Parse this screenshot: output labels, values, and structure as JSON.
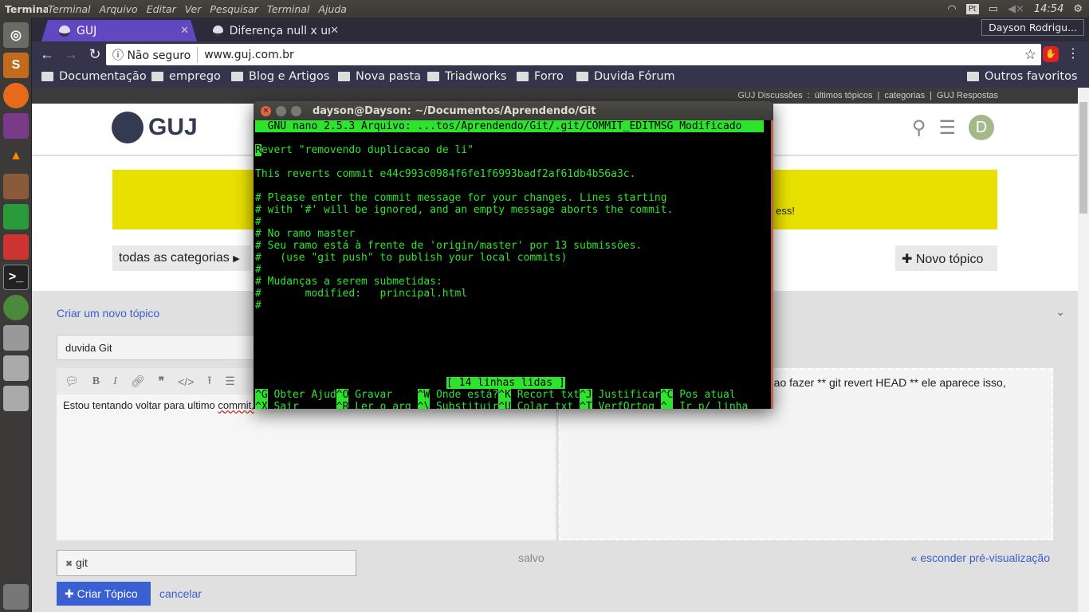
{
  "ubuntu": {
    "app": "Terminal",
    "menu": [
      "Terminal",
      "Arquivo",
      "Editar",
      "Ver",
      "Pesquisar",
      "Terminal",
      "Ajuda"
    ],
    "lang": "Pt",
    "time": "14:54"
  },
  "chrome": {
    "tabs": [
      {
        "title": "GUJ"
      },
      {
        "title": "Diferença null x unc"
      }
    ],
    "user": "Dayson Rodrigu...",
    "security": "Não seguro",
    "url": "www.guj.com.br",
    "bookmarks": [
      "Documentação",
      "emprego",
      "Blog e Artigos",
      "Nova pasta",
      "Triadworks",
      "Forro",
      "Duvida Fórum"
    ],
    "other_bookmarks": "Outros favoritos"
  },
  "guj": {
    "topnav": [
      "GUJ Discussões",
      ":",
      "últimos tópicos",
      "|",
      "categorias",
      "|",
      "GUJ Respostas"
    ],
    "logo": "GUJ",
    "avatar": "D",
    "banner_tail": "ess!",
    "category": "todas as categorias",
    "new_topic": "Novo tópico",
    "composer": {
      "heading": "Criar um novo tópico",
      "title_value": "duvida Git",
      "editor_text_a": "Estou tentando voltar para ultimo ",
      "editor_text_b": "commit,",
      "preview_text": "e ao fazer ** git revert HEAD ** ele aparece isso,",
      "tag": "git",
      "saved": "salvo",
      "hide_preview": "« esconder pré-visualização",
      "create": "Criar Tópico",
      "cancel": "cancelar"
    }
  },
  "terminal": {
    "title": "dayson@Dayson: ~/Documentos/Aprendendo/Git",
    "header": "  GNU nano 2.5.3 Arquivo: ...tos/Aprendendo/Git/.git/COMMIT_EDITMSG Modificado  ",
    "cursor": "R",
    "lines": [
      "evert \"removendo duplicacao de li\"",
      "",
      "This reverts commit e44c993c0984f6fe1f6993badf2af61db4b56a3c.",
      "",
      "# Please enter the commit message for your changes. Lines starting",
      "# with '#' will be ignored, and an empty message aborts the commit.",
      "#",
      "# No ramo master",
      "# Seu ramo está à frente de 'origin/master' por 13 submissões.",
      "#   (use \"git push\" to publish your local commits)",
      "#",
      "# Mudanças a serem submetidas:",
      "#       modified:   principal.html",
      "#"
    ],
    "status": "[ 14 linhas lidas ]",
    "shortcuts": [
      [
        {
          "k": "^G",
          "l": " Obter Ajud"
        },
        {
          "k": "^O",
          "l": " Gravar    "
        },
        {
          "k": "^W",
          "l": " Onde está?"
        },
        {
          "k": "^K",
          "l": " Recort txt"
        },
        {
          "k": "^J",
          "l": " Justificar"
        },
        {
          "k": "^C",
          "l": " Pos atual"
        }
      ],
      [
        {
          "k": "^X",
          "l": " Sair      "
        },
        {
          "k": "^R",
          "l": " Ler o arq "
        },
        {
          "k": "^\\",
          "l": " Substituir"
        },
        {
          "k": "^U",
          "l": " Colar txt "
        },
        {
          "k": "^T",
          "l": " VerfOrtog "
        },
        {
          "k": "^_",
          "l": " Ir p/ linha"
        }
      ]
    ]
  }
}
